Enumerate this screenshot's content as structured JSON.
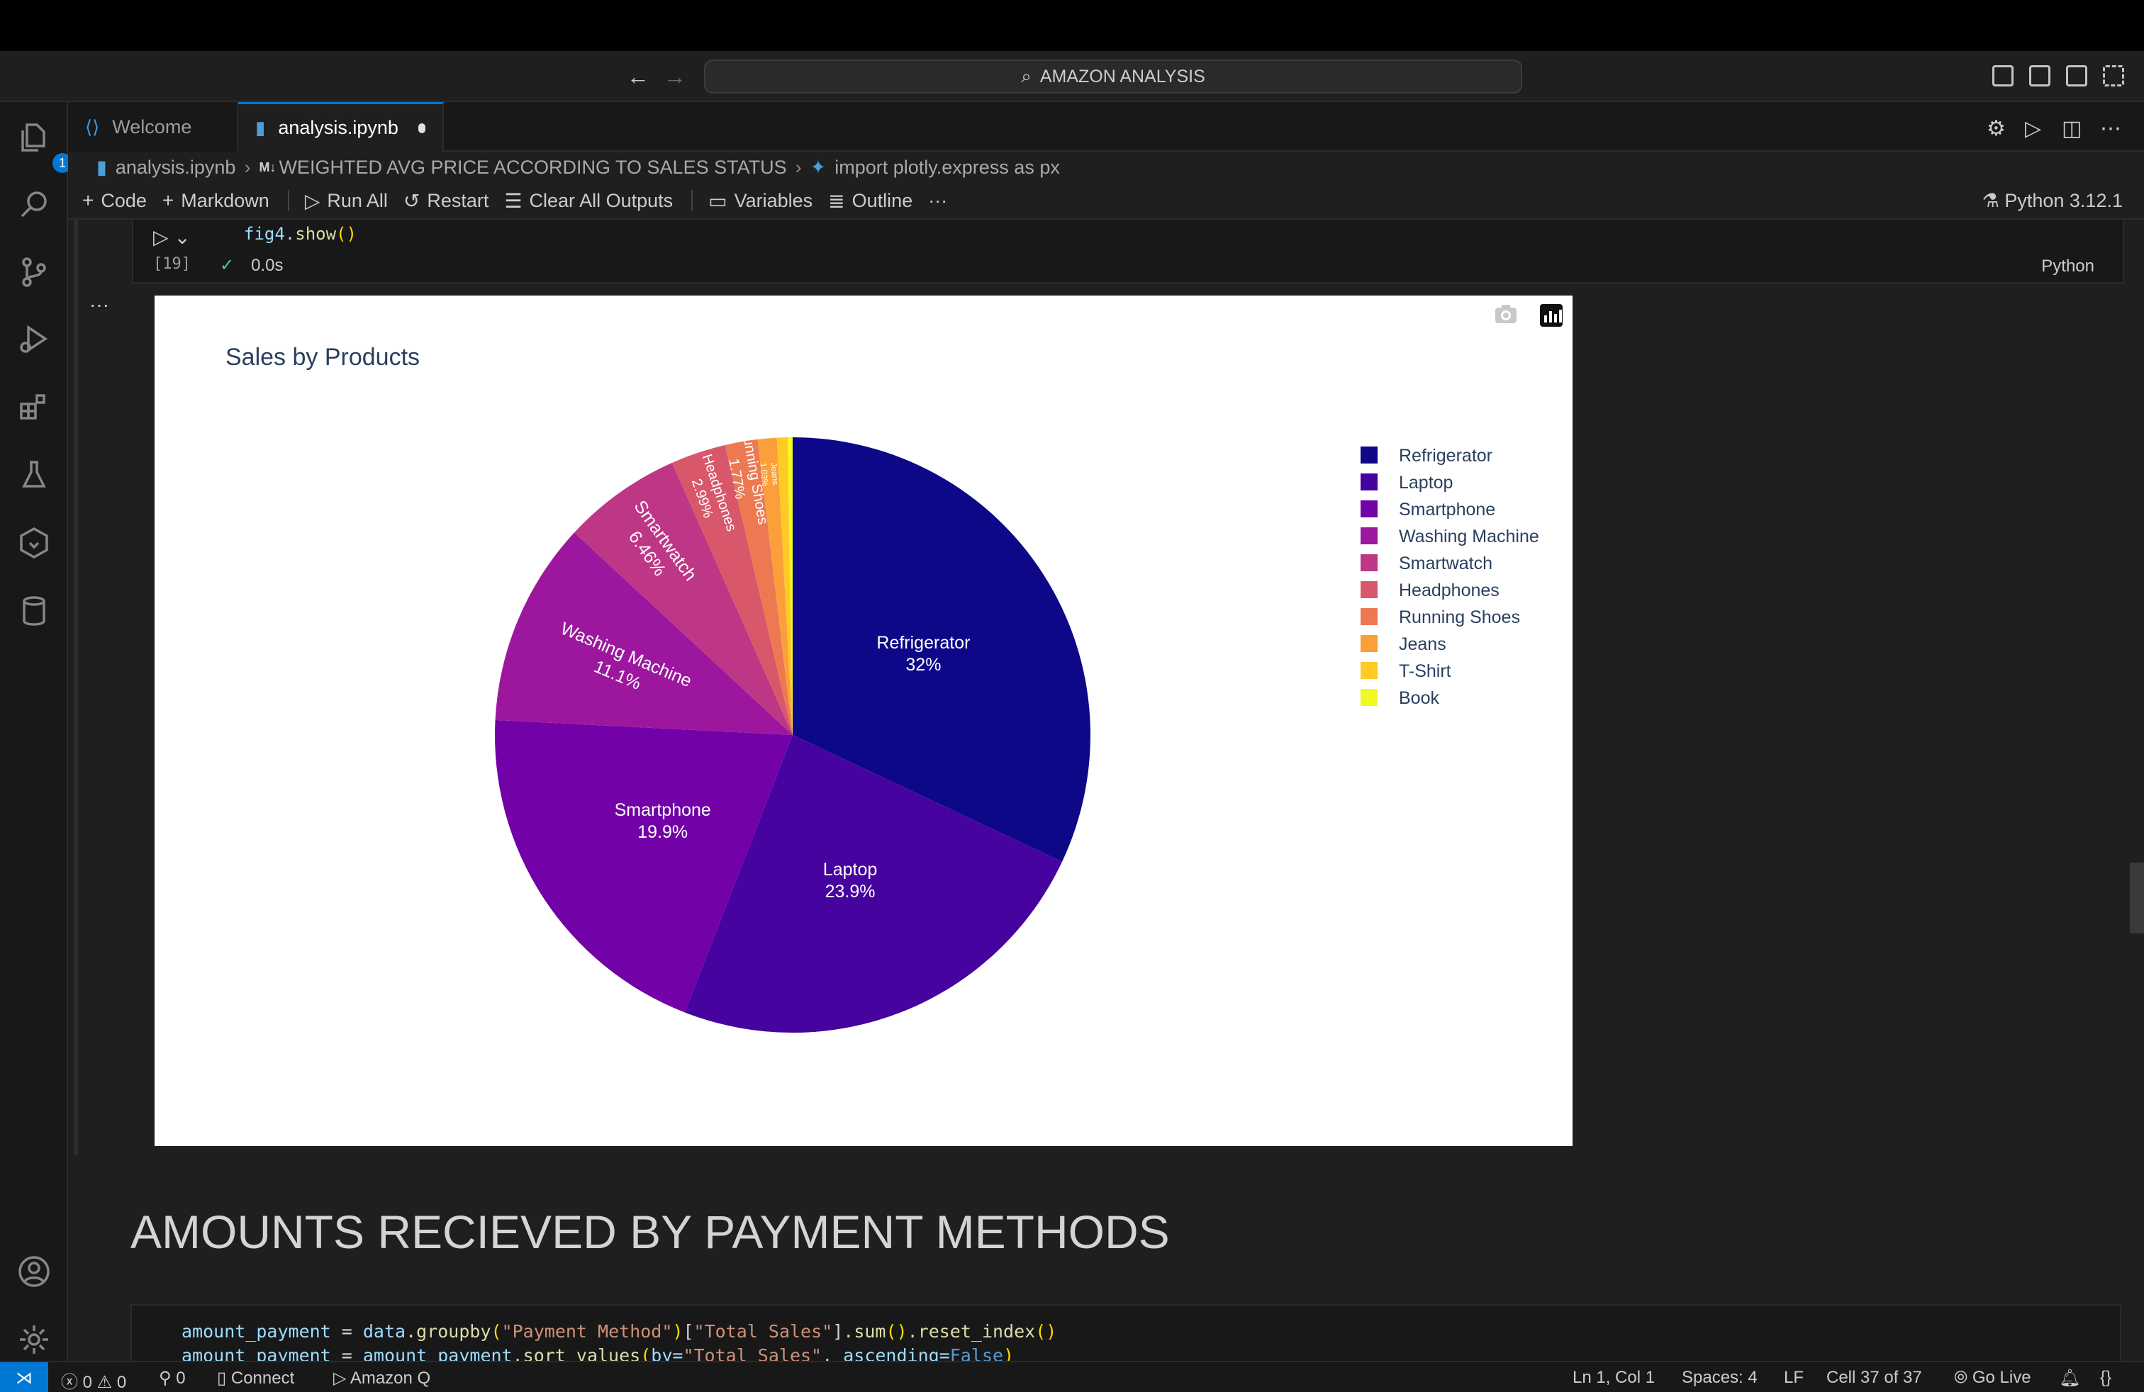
{
  "titlebar": {
    "search_label": "AMAZON ANALYSIS",
    "back_icon": "arrow-left-icon",
    "forward_icon": "arrow-right-icon"
  },
  "activity_bar": {
    "explorer_badge": "1",
    "items": [
      "explorer-icon",
      "search-icon",
      "source-control-icon",
      "run-debug-icon",
      "extensions-icon",
      "testing-icon",
      "remote-icon",
      "database-icon",
      "account-icon",
      "settings-gear-icon"
    ]
  },
  "tabs": [
    {
      "label": "Welcome",
      "icon": "vscode-icon",
      "active": false
    },
    {
      "label": "analysis.ipynb",
      "icon": "notebook-icon",
      "active": true,
      "dirty": true
    }
  ],
  "breadcrumb": {
    "file": "analysis.ipynb",
    "md_badge": "M↓",
    "section": "WEIGHTED AVG PRICE ACCORDING TO SALES STATUS",
    "cell": "import plotly.express as px"
  },
  "toolbar": {
    "code": "Code",
    "markdown": "Markdown",
    "run_all": "Run All",
    "restart": "Restart",
    "clear_outputs": "Clear All Outputs",
    "variables": "Variables",
    "outline": "Outline",
    "more": "···",
    "kernel": "Python 3.12.1"
  },
  "cell_top": {
    "code": "fig4.show()",
    "exec_count": "[19]",
    "duration": "0.0s",
    "language": "Python",
    "output_menu": "···"
  },
  "chart_data": {
    "type": "pie",
    "title": "Sales by Products",
    "labels": [
      "Refrigerator",
      "Laptop",
      "Smartphone",
      "Washing Machine",
      "Smartwatch",
      "Headphones",
      "Running Shoes",
      "Jeans",
      "T-Shirt",
      "Book"
    ],
    "values": [
      32.0,
      23.9,
      19.9,
      11.1,
      6.46,
      2.99,
      1.77,
      1.03,
      0.58,
      0.27
    ],
    "slice_labels": [
      "32%",
      "23.9%",
      "19.9%",
      "11.1%",
      "6.46%",
      "2.99%",
      "1.77%",
      "1.03%",
      "",
      ""
    ],
    "colors": [
      "#0d0887",
      "#46039f",
      "#7201a8",
      "#9c179e",
      "#bd3786",
      "#d8576b",
      "#ed7953",
      "#fb9f3a",
      "#fdca26",
      "#f0f921"
    ],
    "legend_position": "top-right",
    "modebar_icons": [
      "camera-icon",
      "plotly-logo-icon"
    ]
  },
  "markdown": {
    "heading": "AMOUNTS RECIEVED BY PAYMENT METHODS"
  },
  "cell_bottom": {
    "line1": {
      "var": "amount_payment",
      "eq": " = ",
      "obj": "data",
      "m1": ".groupby",
      "s1": "\"Payment Method\"",
      "s2": "\"Total Sales\"",
      "m2": ".sum",
      "m3": ".reset_index"
    },
    "line2": {
      "var": "amount_payment",
      "eq": " = ",
      "obj": "amount_payment",
      "m1": ".sort_values",
      "arg1": "by=",
      "s1": "\"Total Sales\"",
      "arg2": ", ascending=",
      "kw": "False"
    }
  },
  "statusbar": {
    "errors": "0",
    "warnings": "0",
    "ports": "0",
    "connect": "Connect",
    "amazon_q": "Amazon Q",
    "position": "Ln 1, Col 1",
    "spaces": "Spaces: 4",
    "eol": "LF",
    "cell": "Cell 37 of 37",
    "go_live": "Go Live"
  }
}
